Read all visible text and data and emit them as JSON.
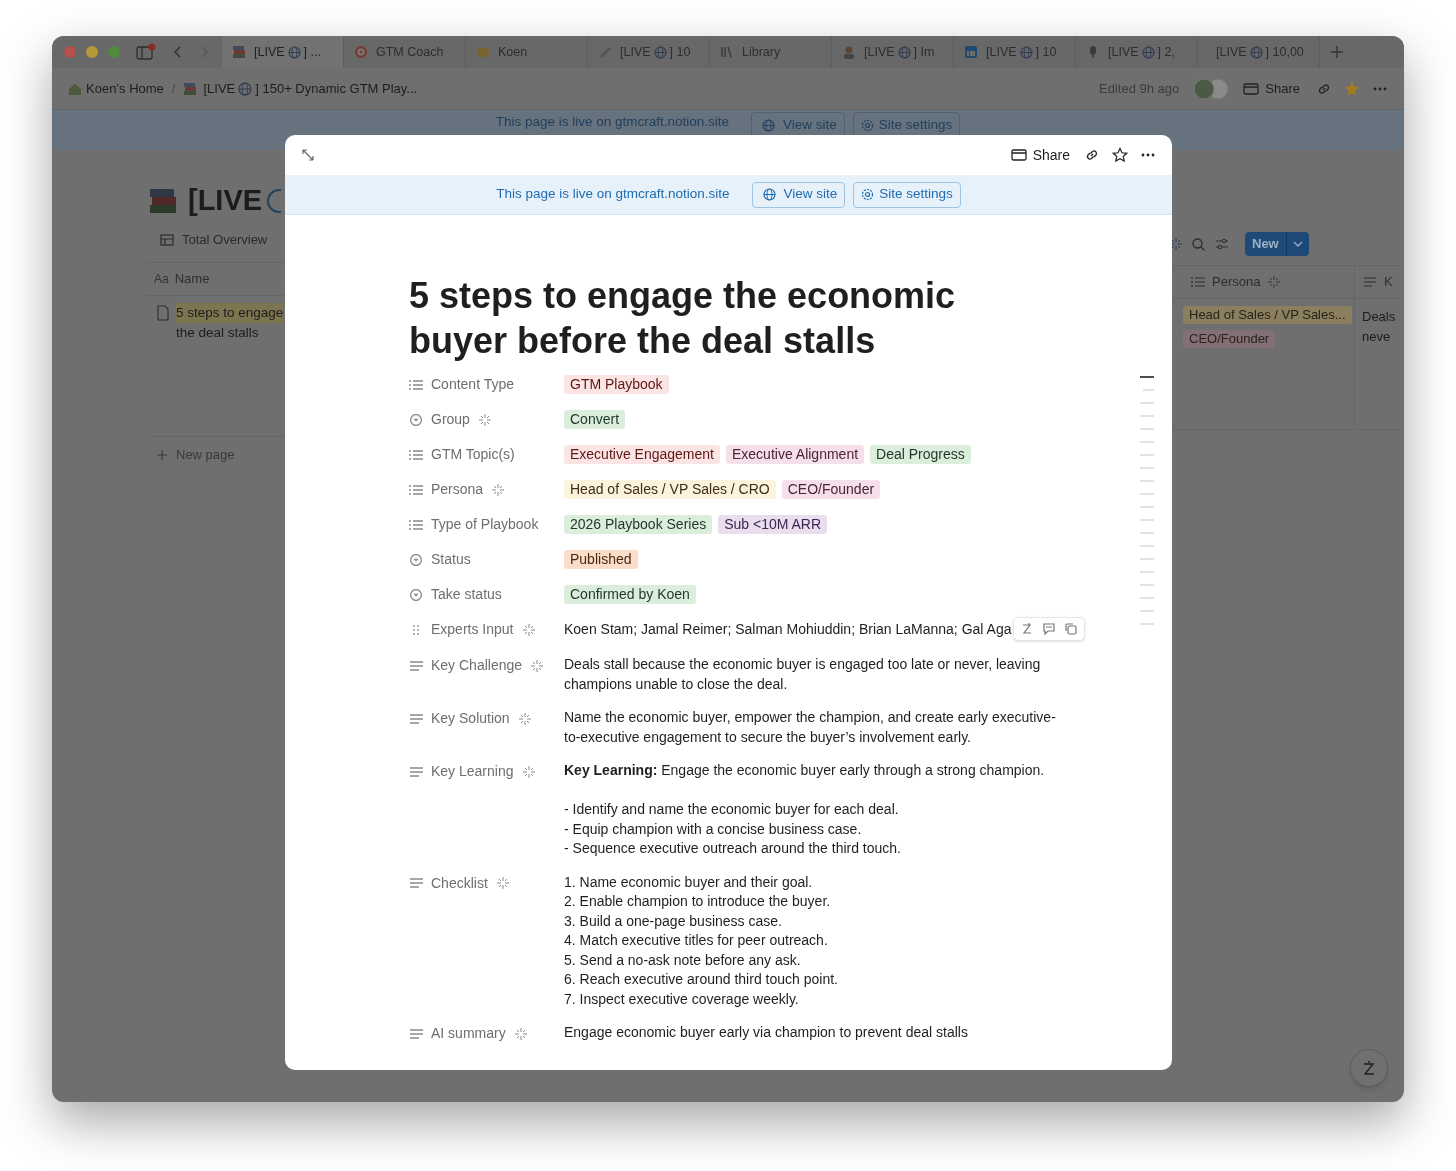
{
  "browser_tabs": [
    {
      "label": "[LIVE",
      "after": "] ...",
      "selected": true
    },
    {
      "label": "GTM Coach",
      "selected": false
    },
    {
      "label": "Koen",
      "selected": false
    },
    {
      "label": "[LIVE",
      "after": "] 10",
      "selected": false
    },
    {
      "label": "Library",
      "selected": false
    },
    {
      "label": "[LIVE",
      "after": "] Im",
      "selected": false
    },
    {
      "label": "[LIVE",
      "after": "] 10",
      "selected": false
    },
    {
      "label": "[LIVE",
      "after": "] 2,",
      "selected": false
    },
    {
      "label": "[LIVE",
      "after": "] 10,00",
      "selected": false
    }
  ],
  "toolbar": {
    "breadcrumbs": [
      {
        "label": "Koen’s Home"
      },
      {
        "label": "[LIVE",
        "after": "] 150+ Dynamic GTM Play..."
      }
    ],
    "separator": "/",
    "edited": "Edited 9h ago",
    "share": "Share",
    "favorite": true
  },
  "background_page": {
    "banner": {
      "text": "This page is live on gtmcraft.notion.site",
      "view_site": "View site",
      "site_settings": "Site settings"
    },
    "title": "[LIVE",
    "view_tab": "Total Overview",
    "name_column": {
      "type_mark": "Aa",
      "label": "Name"
    },
    "row_name_lines": [
      "5 steps to engage",
      "the deal stalls"
    ],
    "new_page": "New page",
    "new_button": "New",
    "columns": [
      {
        "label": "Persona",
        "ai": true
      },
      {
        "label": "K",
        "ai": false
      }
    ],
    "persona_tags": [
      {
        "text": "Head of Sales / VP Sales...",
        "color": "#8a7f5f"
      },
      {
        "text": "CEO/Founder",
        "color": "#836f78"
      }
    ],
    "column_2_lines": [
      "Deals",
      "neve"
    ]
  },
  "modal": {
    "share": "Share",
    "banner": {
      "text": "This page is live on gtmcraft.notion.site",
      "view_site": "View site",
      "site_settings": "Site settings"
    },
    "title": "5 steps to engage the economic buyer before the deal stalls",
    "properties": [
      {
        "label": "Content Type",
        "kind": "multi_select",
        "ai": false,
        "tags": [
          {
            "text": "GTM Playbook",
            "color": "#fbe4e4"
          }
        ]
      },
      {
        "label": "Group",
        "kind": "select",
        "ai": true,
        "tags": [
          {
            "text": "Convert",
            "color": "#dbeddb"
          }
        ]
      },
      {
        "label": "GTM Topic(s)",
        "kind": "multi_select",
        "ai": false,
        "tags": [
          {
            "text": "Executive Engagement",
            "color": "#fbe4e4"
          },
          {
            "text": "Executive Alignment",
            "color": "#f5e0e9"
          },
          {
            "text": "Deal Progress",
            "color": "#dbeddb"
          }
        ]
      },
      {
        "label": "Persona",
        "kind": "multi_select",
        "ai": true,
        "tags": [
          {
            "text": "Head of Sales / VP Sales / CRO",
            "color": "#fbf3db"
          },
          {
            "text": "CEO/Founder",
            "color": "#f5e0e9"
          }
        ]
      },
      {
        "label": "Type of Playbook",
        "kind": "multi_select",
        "ai": false,
        "tags": [
          {
            "text": "2026 Playbook Series",
            "color": "#dbeddb"
          },
          {
            "text": "Sub <10M ARR",
            "color": "#e8deee"
          }
        ]
      },
      {
        "label": "Status",
        "kind": "select",
        "ai": false,
        "tags": [
          {
            "text": "Published",
            "color": "#fadec9"
          }
        ]
      },
      {
        "label": "Take status",
        "kind": "select",
        "ai": false,
        "tags": [
          {
            "text": "Confirmed by Koen",
            "color": "#dbeddb"
          }
        ]
      },
      {
        "label": "Experts Input",
        "kind": "text",
        "ai": true,
        "hovered": true,
        "blocks": [
          [
            "Koen Stam; Jamal Reimer; Salman Mohiuddin; Brian LaManna; Gal Aga"
          ]
        ]
      },
      {
        "label": "Key Challenge",
        "kind": "text",
        "ai": true,
        "blocks": [
          [
            "Deals stall because the economic buyer is engaged too late or never, leaving champions unable to close the deal."
          ]
        ]
      },
      {
        "label": "Key Solution",
        "kind": "text",
        "ai": true,
        "blocks": [
          [
            "Name the economic buyer, empower the champion, and create early executive-to-executive engagement to secure the buyer’s involvement early."
          ]
        ]
      },
      {
        "label": "Key Learning",
        "kind": "text",
        "ai": true,
        "blocks": [
          [
            "**Key Learning:** Engage the economic buyer early through a strong champion."
          ],
          [
            "- Identify and name the economic buyer for each deal.",
            "- Equip champion with a concise business case.",
            "- Sequence executive outreach around the third touch."
          ]
        ]
      },
      {
        "label": "Checklist",
        "kind": "text",
        "ai": true,
        "blocks": [
          [
            "1. Name economic buyer and their goal.",
            "2. Enable champion to introduce the buyer.",
            "3. Build a one-page business case.",
            "4. Match executive titles for peer outreach.",
            "5. Send a no-ask note before any ask.",
            "6. Reach executive around third touch point.",
            "7. Inspect executive coverage weekly."
          ]
        ]
      },
      {
        "label": "AI summary",
        "kind": "text",
        "ai": true,
        "blocks": [
          [
            "Engage economic buyer early via champion to prevent deal stalls"
          ]
        ]
      }
    ]
  }
}
